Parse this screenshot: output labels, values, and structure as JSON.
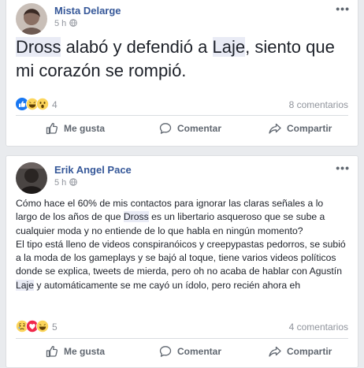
{
  "posts": [
    {
      "author": "Mista Delarge",
      "time": "5 h",
      "text_parts": [
        {
          "t": "Dross",
          "hl": true
        },
        {
          "t": " alabó y defendió a ",
          "hl": false
        },
        {
          "t": "Laje",
          "hl": true
        },
        {
          "t": ", siento que mi corazón se rompió.",
          "hl": false
        }
      ],
      "reaction_count": "4",
      "comments": "8 comentarios",
      "actions": {
        "like": "Me gusta",
        "comment": "Comentar",
        "share": "Compartir"
      }
    },
    {
      "author": "Erik Angel Pace",
      "time": "5 h",
      "text_parts": [
        {
          "t": "Cómo hace el 60% de mis contactos para ignorar las claras señales a lo largo de los años de que ",
          "hl": false
        },
        {
          "t": "Dross",
          "hl": true
        },
        {
          "t": " es un libertario asqueroso que se sube a cualquier moda y no entiende de lo que habla en ningún momento?\nEl tipo está lleno de videos conspiranóicos y creepypastas pedorros, se subió a la moda de los gameplays y se bajó al toque, tiene varios videos políticos donde se explica, tweets de mierda, pero oh no acaba de hablar con Agustín ",
          "hl": false
        },
        {
          "t": "Laje",
          "hl": true
        },
        {
          "t": " y automáticamente se me cayó un ídolo, pero recién ahora eh",
          "hl": false
        }
      ],
      "reaction_count": "5",
      "comments": "4 comentarios",
      "actions": {
        "like": "Me gusta",
        "comment": "Comentar",
        "share": "Compartir"
      }
    }
  ],
  "colors": {
    "author": "#365899",
    "meta": "#90949c",
    "highlight": "#e9ebf5",
    "like_blue": "#1877f2",
    "heart_red": "#f0284a",
    "emoji_yellow": "#fcd55b"
  },
  "icons": {
    "post1_reactions": [
      "like-icon",
      "haha-icon",
      "wow-icon"
    ],
    "post2_reactions": [
      "sad-icon",
      "love-icon",
      "haha-icon"
    ]
  }
}
